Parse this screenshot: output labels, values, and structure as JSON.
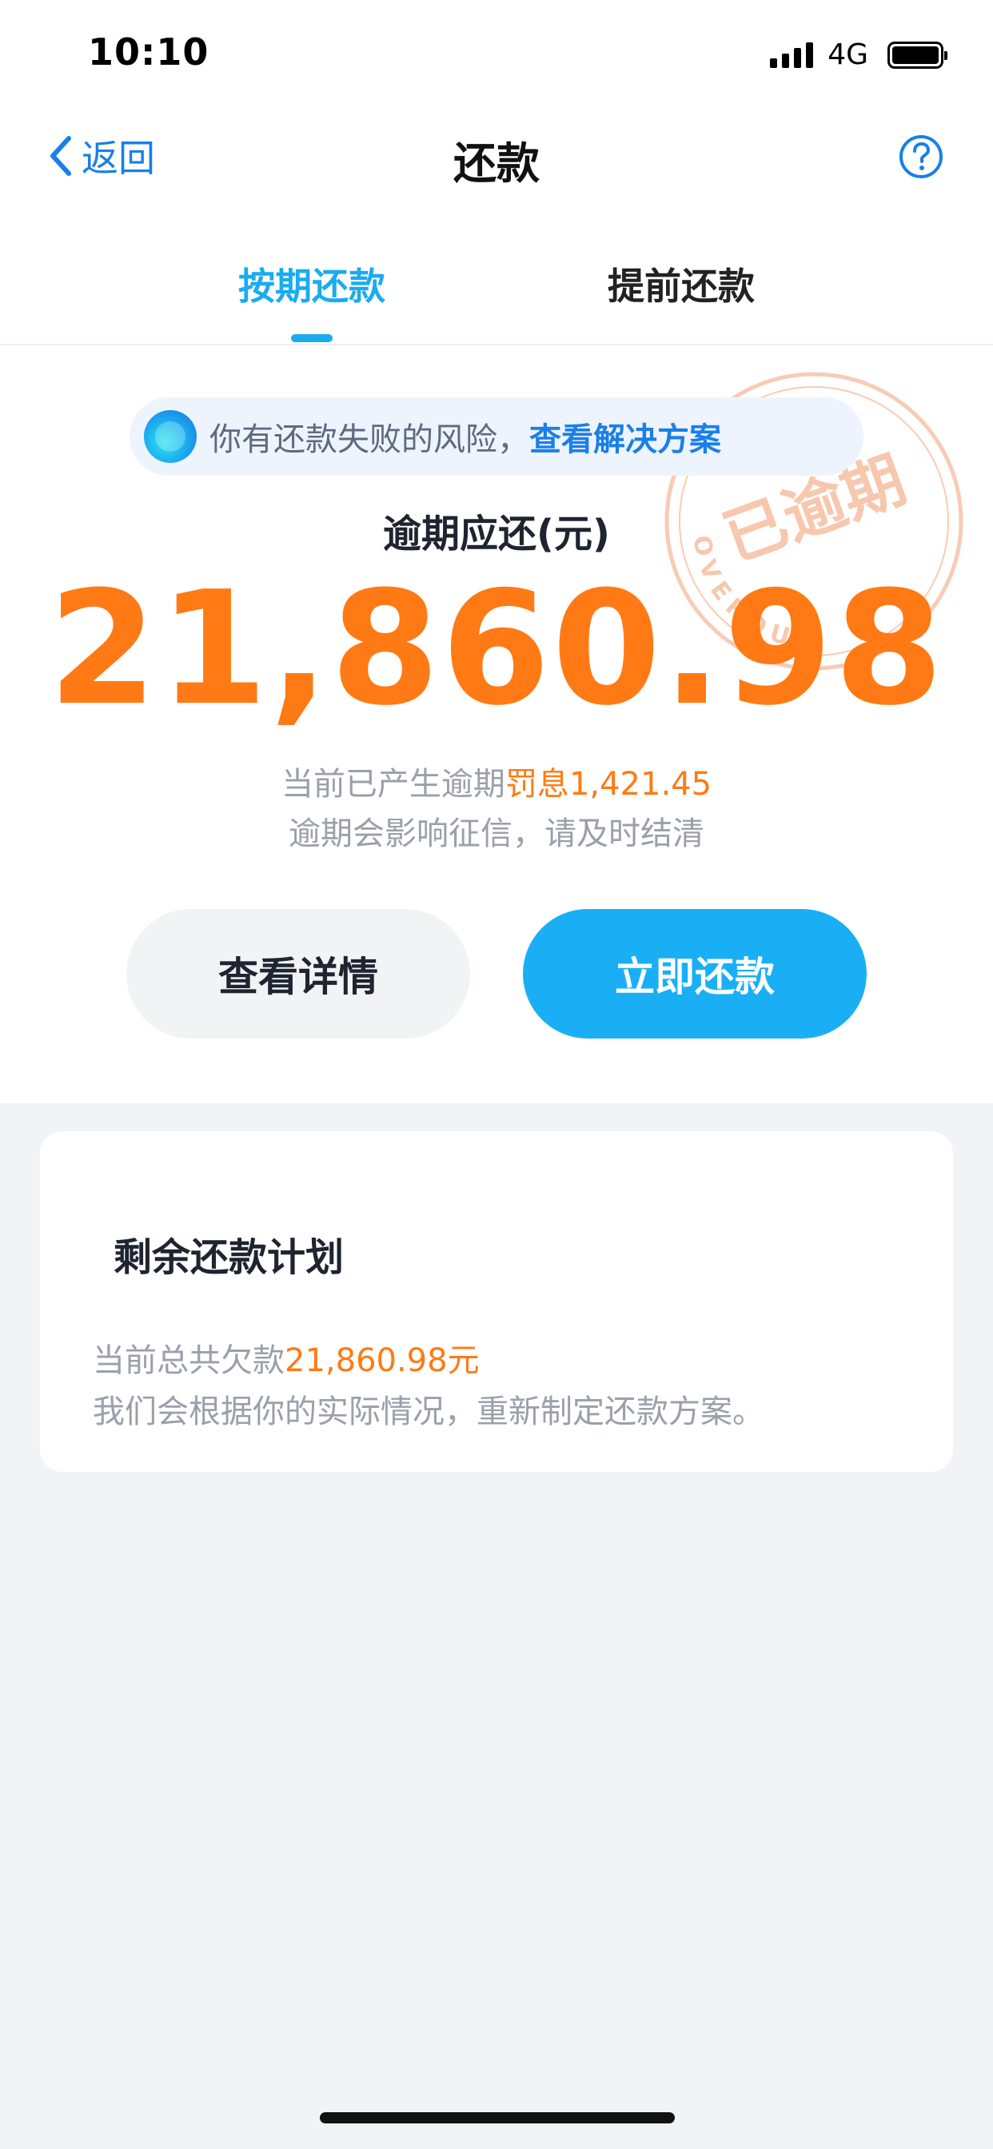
{
  "status_bar": {
    "time": "10:10",
    "network": "4G"
  },
  "nav": {
    "back_label": "返回",
    "title": "还款"
  },
  "tabs": [
    {
      "label": "按期还款",
      "active": true
    },
    {
      "label": "提前还款",
      "active": false
    }
  ],
  "risk_banner": {
    "text": "你有还款失败的风险，",
    "link": "查看解决方案"
  },
  "stamp": {
    "text": "已逾期",
    "subtext": "OVERDUE"
  },
  "amount": {
    "label": "逾期应还(元)",
    "value": "21,860.98"
  },
  "penalty": {
    "prefix": "当前已产生逾期",
    "label": "罚息",
    "amount": "1,421.45"
  },
  "credit_warning": "逾期会影响征信，请及时结清",
  "buttons": {
    "detail": "查看详情",
    "pay": "立即还款"
  },
  "plan": {
    "title": "剩余还款计划",
    "debt_prefix": "当前总共欠款",
    "debt_amount": "21,860.98元",
    "description": "我们会根据你的实际情况，重新制定还款方案。"
  },
  "colors": {
    "accent": "#1AABF0",
    "link": "#1A7FE8",
    "warning_orange": "#FF7A14",
    "muted_text": "#9AA0AA",
    "page_background": "#F2F3F7"
  }
}
